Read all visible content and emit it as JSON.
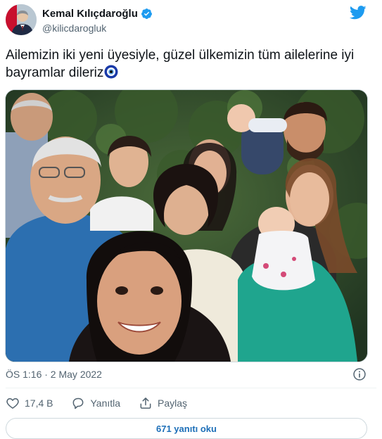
{
  "colors": {
    "twitter_blue": "#1d9bf0",
    "link_blue": "#1d6fb8",
    "text_primary": "#0f1419",
    "text_secondary": "#536471",
    "border": "#cfd9de"
  },
  "author": {
    "display_name": "Kemal Kılıçdaroğlu",
    "handle": "@kilicdarogluk",
    "verified_icon": "verified-badge-icon"
  },
  "tweet": {
    "text": "Ailemizin iki yeni üyesiyle, güzel ülkemizin tüm ailelerine iyi bayramlar dileriz",
    "emoji": "nazar-boncugu",
    "timestamp": "ÖS 1:16 · 2 May 2022"
  },
  "actions": {
    "like_count": "17,4 B",
    "reply_label": "Yanıtla",
    "share_label": "Paylaş"
  },
  "replies_button": {
    "label": "671 yanıtı oku"
  },
  "icons": [
    "twitter-logo-icon",
    "info-icon",
    "heart-icon",
    "reply-icon",
    "share-icon"
  ]
}
